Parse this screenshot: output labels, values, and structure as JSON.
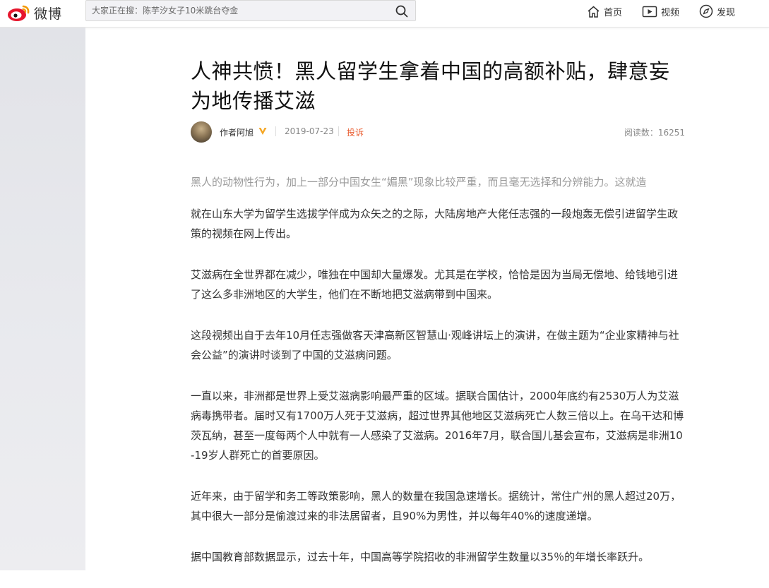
{
  "header": {
    "logo_text": "微博",
    "search_placeholder": "大家正在搜：陈芋汐女子10米跳台夺金",
    "nav": [
      {
        "label": "首页",
        "icon": "home-icon"
      },
      {
        "label": "视频",
        "icon": "video-icon"
      },
      {
        "label": "发现",
        "icon": "compass-icon"
      }
    ]
  },
  "article": {
    "title": "人神共愤！黑人留学生拿着中国的高额补贴，肆意妄为地传播艾滋",
    "author": "作者阿旭",
    "date": "2019-07-23",
    "report_label": "投诉",
    "reads": "阅读数：16251",
    "summary": "黑人的动物性行为，加上一部分中国女生“媚黑”现象比较严重，而且毫无选择和分辨能力。这就造",
    "paragraphs": [
      "就在山东大学为留学生选拔学伴成为众矢之的之际，大陆房地产大佬任志强的一段炮轰无偿引进留学生政策的视频在网上传出。",
      "艾滋病在全世界都在减少，唯独在中国却大量爆发。尤其是在学校，恰恰是因为当局无偿地、给钱地引进了这么多非洲地区的大学生，他们在不断地把艾滋病带到中国来。",
      "这段视频出自于去年10月任志强做客天津高新区智慧山·观峰讲坛上的演讲，在做主题为“企业家精神与社会公益”的演讲时谈到了中国的艾滋病问题。",
      "一直以来，非洲都是世界上受艾滋病影响最严重的区域。据联合国估计，2000年底约有2530万人为艾滋病毒携带者。届时又有1700万人死于艾滋病，超过世界其他地区艾滋病死亡人数三倍以上。在乌干达和博茨瓦纳，甚至一度每两个人中就有一人感染了艾滋病。2016年7月，联合国儿基会宣布，艾滋病是非洲10-19岁人群死亡的首要原因。",
      "近年来，由于留学和务工等政策影响，黑人的数量在我国急速增长。据统计，常住广州的黑人超过20万，其中很大一部分是偷渡过来的非法居留者，且90%为男性，并以每年40%的速度递增。",
      "据中国教育部数据显示，过去十年，中国高等学院招收的非洲留学生数量以35％的年增长率跃升。"
    ]
  },
  "colors": {
    "accent_orange": "#e8592c",
    "verified_gold": "#f5a623",
    "text": "#333333",
    "muted": "#999999"
  }
}
